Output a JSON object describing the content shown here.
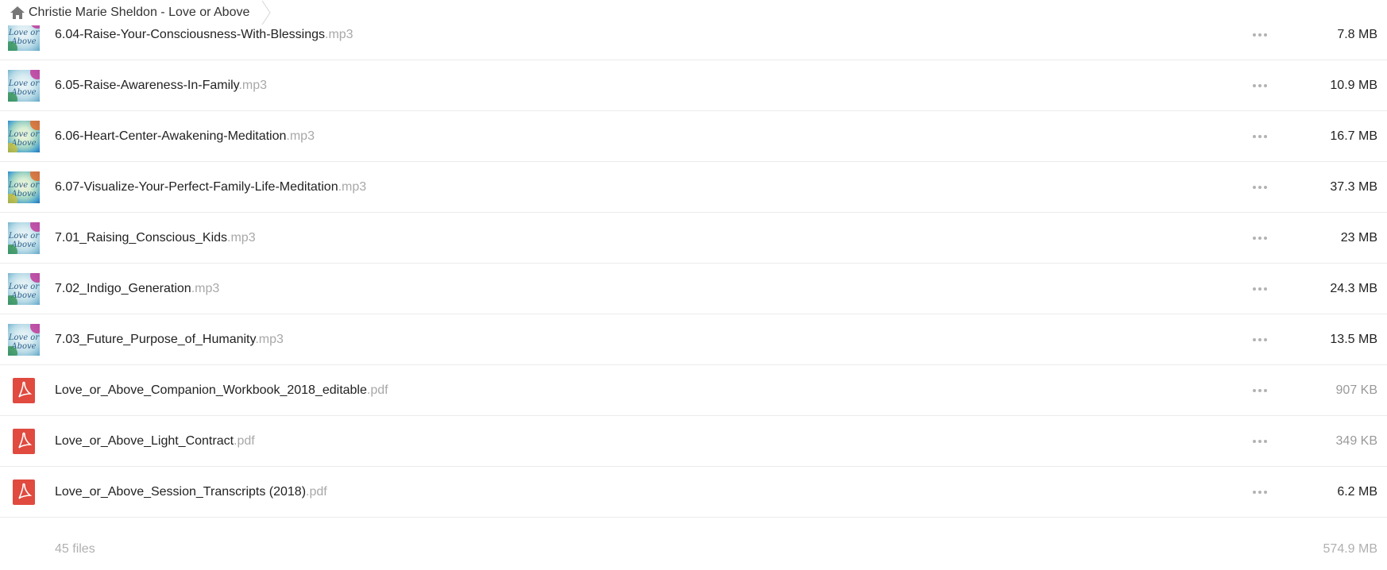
{
  "breadcrumb": {
    "label": "Christie Marie Sheldon - Love or Above",
    "icon": "home-icon"
  },
  "colors": {
    "pdf_red": "#e04a3f",
    "extension_gray": "#a8a8a8",
    "divider": "#ebebeb"
  },
  "files": [
    {
      "name": "6.04-Raise-Your-Consciousness-With-Blessings",
      "ext": ".mp3",
      "size": "7.8 MB",
      "type": "audio",
      "art": "Love or Above"
    },
    {
      "name": "6.05-Raise-Awareness-In-Family",
      "ext": ".mp3",
      "size": "10.9 MB",
      "type": "audio",
      "art": "Love or Above"
    },
    {
      "name": "6.06-Heart-Center-Awakening-Meditation",
      "ext": ".mp3",
      "size": "16.7 MB",
      "type": "audio-alt",
      "art": "Love or Above"
    },
    {
      "name": "6.07-Visualize-Your-Perfect-Family-Life-Meditation",
      "ext": ".mp3",
      "size": "37.3 MB",
      "type": "audio-alt",
      "art": "Love or Above"
    },
    {
      "name": "7.01_Raising_Conscious_Kids",
      "ext": ".mp3",
      "size": "23 MB",
      "type": "audio",
      "art": "Love or Above"
    },
    {
      "name": "7.02_Indigo_Generation",
      "ext": ".mp3",
      "size": "24.3 MB",
      "type": "audio",
      "art": "Love or Above"
    },
    {
      "name": "7.03_Future_Purpose_of_Humanity",
      "ext": ".mp3",
      "size": "13.5 MB",
      "type": "audio",
      "art": "Love or Above"
    },
    {
      "name": "Love_or_Above_Companion_Workbook_2018_editable",
      "ext": ".pdf",
      "size": "907 KB",
      "type": "pdf"
    },
    {
      "name": "Love_or_Above_Light_Contract",
      "ext": ".pdf",
      "size": "349 KB",
      "type": "pdf"
    },
    {
      "name": "Love_or_Above_Session_Transcripts (2018)",
      "ext": ".pdf",
      "size": "6.2 MB",
      "type": "pdf"
    }
  ],
  "summary": {
    "count": "45 files",
    "total_size": "574.9 MB"
  }
}
